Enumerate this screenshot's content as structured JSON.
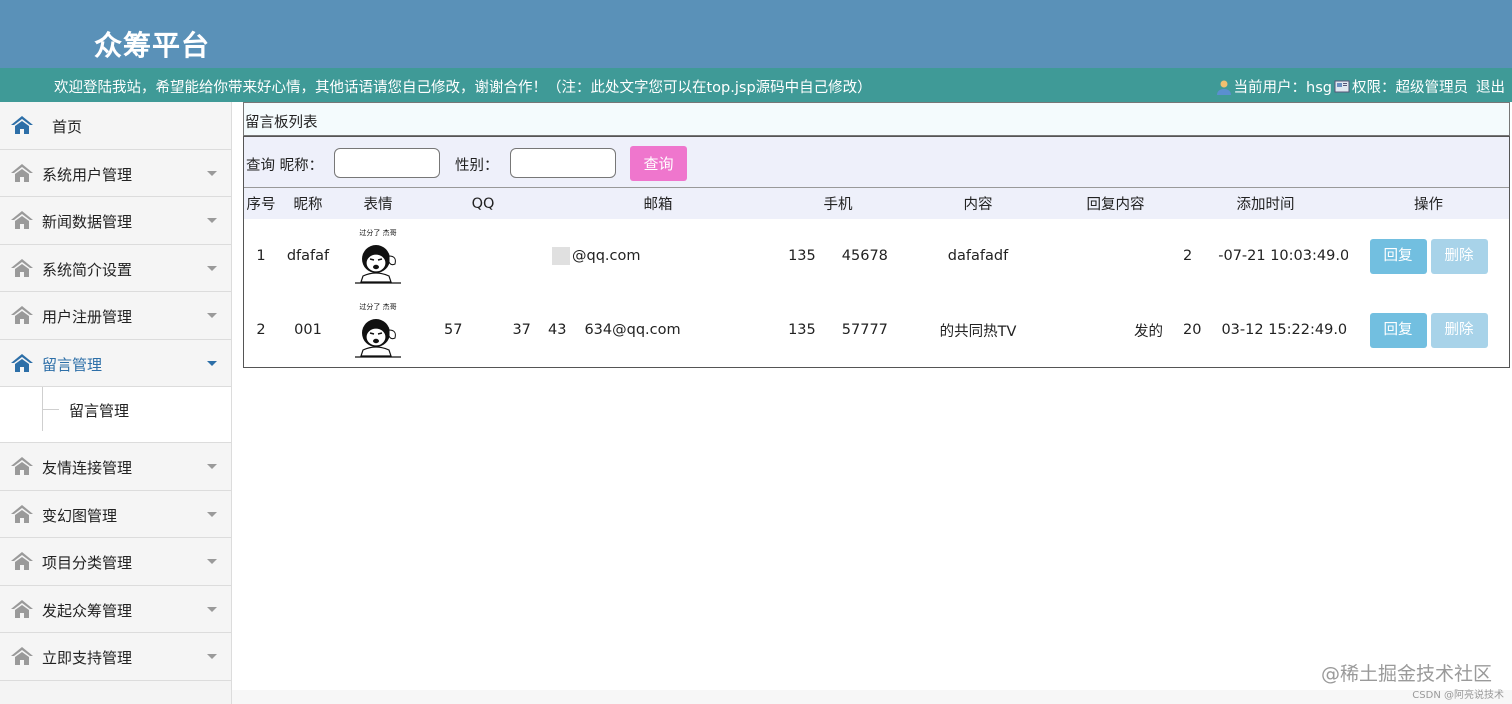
{
  "header": {
    "logo": "众筹平台"
  },
  "topbar": {
    "welcome": "欢迎登陆我站，希望能给你带来好心情，其他话语请您自己修改，谢谢合作！（注：此处文字您可以在top.jsp源码中自己修改）",
    "current_user_label": "当前用户：hsg",
    "permission_label": "权限：超级管理员",
    "logout": "退出"
  },
  "sidebar": {
    "home": "首页",
    "items": [
      "系统用户管理",
      "新闻数据管理",
      "系统简介设置",
      "用户注册管理",
      "留言管理",
      "友情连接管理",
      "变幻图管理",
      "项目分类管理",
      "发起众筹管理",
      "立即支持管理"
    ],
    "active_sub": "留言管理"
  },
  "panel": {
    "title": "留言板列表"
  },
  "search": {
    "label_nickname": "查询 昵称：",
    "label_gender": "性别：",
    "button": "查询"
  },
  "table": {
    "headers": [
      "序号",
      "昵称",
      "表情",
      "QQ",
      "邮箱",
      "手机",
      "内容",
      "回复内容",
      "添加时间",
      "操作"
    ],
    "rows": [
      {
        "no": "1",
        "nick": "dfafaf",
        "emoji_caption": "过分了 杰哥",
        "qq": "",
        "email": "@qq.com",
        "phone_a": "135",
        "phone_b": "45678",
        "content": "dafafadf",
        "reply": "",
        "time_a": "2",
        "time_b": "-07-21 10:03:49.0"
      },
      {
        "no": "2",
        "nick": "001",
        "emoji_caption": "过分了 杰哥",
        "qq_a": "57",
        "qq_b": "37",
        "qq_c": "43",
        "email": "634@qq.com",
        "phone_a": "135",
        "phone_b": "57777",
        "content": "的共同热TV",
        "reply": "发的",
        "time_a": "20",
        "time_b": "03-12 15:22:49.0"
      }
    ],
    "actions": {
      "reply": "回复",
      "delete": "删除"
    }
  },
  "watermark": {
    "main": "@稀土掘金技术社区",
    "sub": "CSDN @阿亮说技术"
  },
  "colors": {
    "header": "#5a91b8",
    "topbar": "#3f9a97",
    "query_button": "#ef76cd",
    "reply_button": "#72bfe0",
    "delete_button": "#a8d3e9"
  }
}
